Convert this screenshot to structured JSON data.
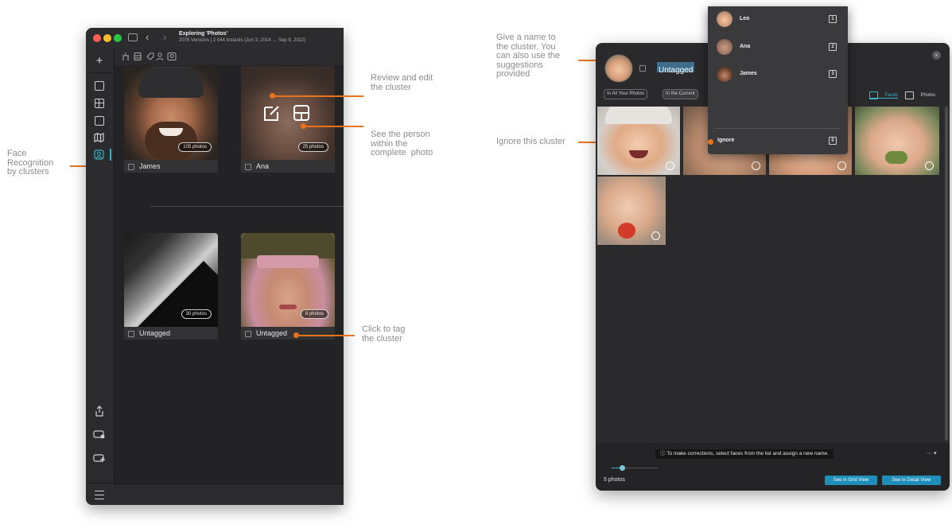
{
  "annotations": {
    "face_recognition": "Face\nRecognition\nby clusters",
    "review_edit": "Review and edit\nthe cluster",
    "see_person": "See the person\nwithin the\ncomplete  photo",
    "click_tag": "Click to tag\nthe cluster",
    "give_name": "Give a name to\nthe cluster. You\ncan also use the\nsuggestions\nprovided",
    "ignore": "Ignore this cluster"
  },
  "left_window": {
    "title": "Exploring 'Photos'",
    "subtitle": "2076 Versions | 2 044 Instants (Jun 3, 2014 → Sep 9, 2022)",
    "clusters": [
      {
        "name": "James",
        "count": "105 photos"
      },
      {
        "name": "Ana",
        "count": "25 photos"
      },
      {
        "name": "Untagged",
        "count": "30 photos"
      },
      {
        "name": "Untagged",
        "count": "8 photos"
      }
    ]
  },
  "right_window": {
    "cluster_name": "Untagged",
    "filters": [
      "In All Your Photos",
      "In the Current"
    ],
    "view_toggle": {
      "faces": "Faces",
      "photos": "Photos"
    },
    "info": "To make corrections, select faces from the list and assign a new name.",
    "more": "··· ▾",
    "photo_count": "5 photos",
    "btn_grid": "See in Grid View",
    "btn_detail": "See in Detail View",
    "suggestions": [
      {
        "name": "Leo",
        "key": "1"
      },
      {
        "name": "Ana",
        "key": "2"
      },
      {
        "name": "James",
        "key": "3"
      }
    ],
    "ignore": {
      "label": "Ignore",
      "key": "0"
    }
  },
  "colors": {
    "accent": "#e8731c",
    "button": "#1e8fb8",
    "window_bg": "#232325"
  }
}
